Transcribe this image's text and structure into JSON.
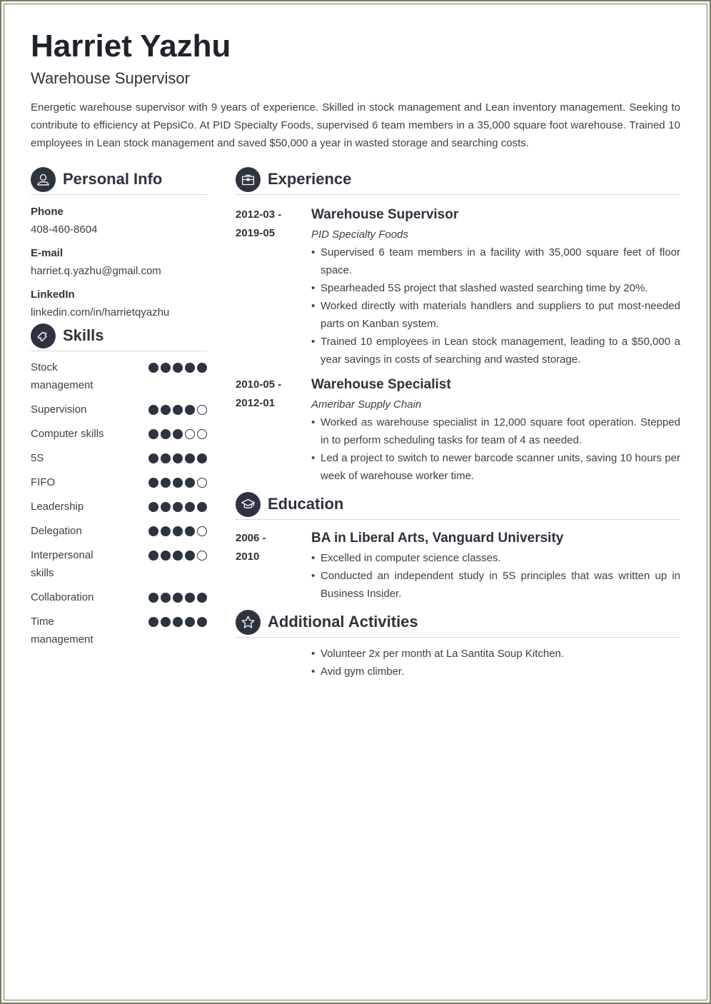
{
  "header": {
    "name": "Harriet Yazhu",
    "title": "Warehouse Supervisor",
    "summary": "Energetic warehouse supervisor with 9 years of experience. Skilled in stock management and Lean inventory management. Seeking to contribute to efficiency at PepsiCo. At PID Specialty Foods, supervised 6 team members in a 35,000 square foot warehouse. Trained 10 employees in Lean stock management and saved $50,000 a year in wasted storage and searching costs."
  },
  "personal_info": {
    "heading": "Personal Info",
    "icon": "person-icon",
    "fields": [
      {
        "label": "Phone",
        "value": "408-460-8604"
      },
      {
        "label": "E-mail",
        "value": "harriet.q.yazhu@gmail.com"
      },
      {
        "label": "LinkedIn",
        "value": "linkedin.com/in/harrietqyazhu"
      }
    ]
  },
  "skills": {
    "heading": "Skills",
    "icon": "puzzle-icon",
    "max_rating": 5,
    "items": [
      {
        "name": "Stock management",
        "rating": 5
      },
      {
        "name": "Supervision",
        "rating": 4
      },
      {
        "name": "Computer skills",
        "rating": 3
      },
      {
        "name": "5S",
        "rating": 5
      },
      {
        "name": "FIFO",
        "rating": 4
      },
      {
        "name": "Leadership",
        "rating": 5
      },
      {
        "name": "Delegation",
        "rating": 4
      },
      {
        "name": "Interpersonal skills",
        "rating": 4
      },
      {
        "name": "Collaboration",
        "rating": 5
      },
      {
        "name": "Time management",
        "rating": 5
      }
    ]
  },
  "experience": {
    "heading": "Experience",
    "icon": "briefcase-icon",
    "entries": [
      {
        "date_start": "2012-03 -",
        "date_end": "2019-05",
        "title": "Warehouse Supervisor",
        "org": "PID Specialty Foods",
        "bullets": [
          "Supervised 6 team members in a facility with 35,000 square feet of floor space.",
          "Spearheaded 5S project that slashed wasted searching time by 20%.",
          "Worked directly with materials handlers and suppliers to put most-needed parts on Kanban system.",
          "Trained 10 employees in Lean stock management, leading to a $50,000 a year savings in costs of searching and wasted storage."
        ]
      },
      {
        "date_start": "2010-05 -",
        "date_end": "2012-01",
        "title": "Warehouse Specialist",
        "org": "Ameribar Supply Chain",
        "bullets": [
          "Worked as warehouse specialist in 12,000 square foot operation. Stepped in to perform scheduling tasks for team of 4 as needed.",
          "Led a project to switch to newer barcode scanner units, saving 10 hours per week of warehouse worker time."
        ]
      }
    ]
  },
  "education": {
    "heading": "Education",
    "icon": "graduation-cap-icon",
    "entries": [
      {
        "date_start": "2006 -",
        "date_end": "2010",
        "title": "BA in Liberal Arts, Vanguard University",
        "bullets": [
          "Excelled in computer science classes.",
          "Conducted an independent study in 5S principles that was written up in Business Insider."
        ]
      }
    ]
  },
  "activities": {
    "heading": "Additional Activities",
    "icon": "star-icon",
    "bullets": [
      "Volunteer 2x per month at La Santita Soup Kitchen.",
      "Avid gym climber."
    ]
  }
}
